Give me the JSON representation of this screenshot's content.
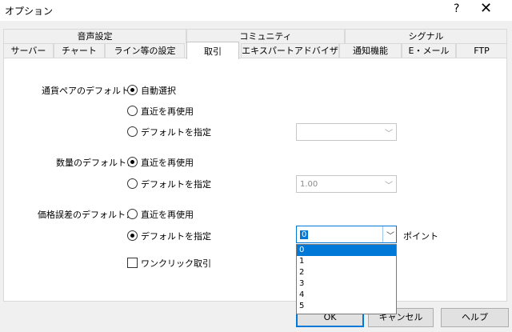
{
  "window": {
    "title": "オプション",
    "help_label": "?",
    "close_label": "✕"
  },
  "tabs": {
    "row1": [
      {
        "label": "音声設定"
      },
      {
        "label": "コミュニティ"
      },
      {
        "label": "シグナル"
      }
    ],
    "row2": [
      {
        "label": "サーバー"
      },
      {
        "label": "チャート"
      },
      {
        "label": "ライン等の設定"
      },
      {
        "label": "取引",
        "active": true
      },
      {
        "label": "エキスパートアドバイザ"
      },
      {
        "label": "通知機能"
      },
      {
        "label": "E・メール"
      },
      {
        "label": "FTP"
      }
    ]
  },
  "trade": {
    "pair_default": {
      "label": "通貨ペアのデフォルト：",
      "options": [
        "自動選択",
        "直近を再使用",
        "デフォルトを指定"
      ],
      "selected": 0,
      "combo_value": ""
    },
    "volume_default": {
      "label": "数量のデフォルト：",
      "options": [
        "直近を再使用",
        "デフォルトを指定"
      ],
      "selected": 0,
      "combo_value": "1.00"
    },
    "deviation_default": {
      "label": "価格誤差のデフォルト：",
      "options": [
        "直近を再使用",
        "デフォルトを指定"
      ],
      "selected": 1,
      "combo_value": "0",
      "unit": "ポイント",
      "dropdown_options": [
        "0",
        "1",
        "2",
        "3",
        "4",
        "5"
      ],
      "dropdown_selected": 0
    },
    "one_click": {
      "label": "ワンクリック取引",
      "checked": false
    }
  },
  "buttons": {
    "ok": "OK",
    "cancel": "キャンセル",
    "help": "ヘルプ"
  },
  "icons": {
    "dropdown_arrow": "chevron-down-icon"
  }
}
